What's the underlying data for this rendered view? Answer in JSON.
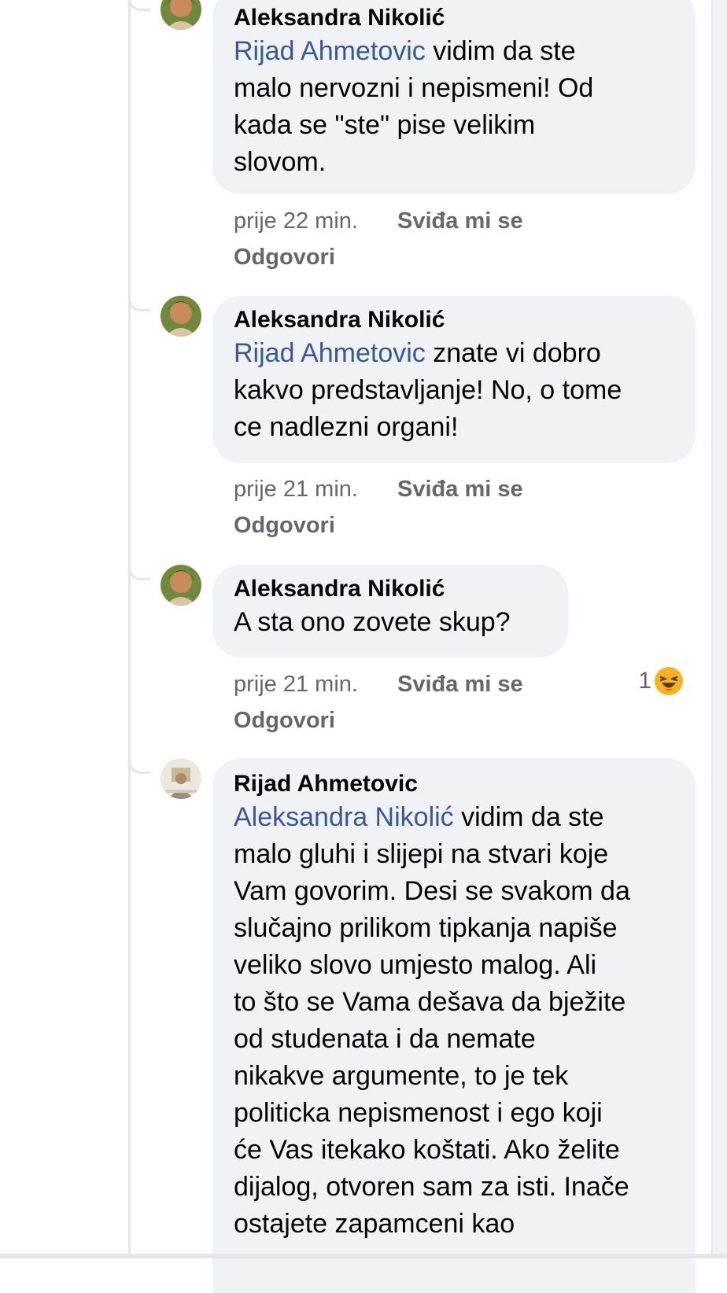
{
  "comments": [
    {
      "author": "Aleksandra Nikolić",
      "mention": "Rijad Ahmetovic",
      "body": " vidim da ste\nmalo nervozni i nepismeni! Od\nkada se \"ste\" pise velikim\nslovom.",
      "time": "prije 22 min.",
      "like": "Sviđa mi se",
      "reply": "Odgovori"
    },
    {
      "author": "Aleksandra Nikolić",
      "mention": "Rijad Ahmetovic",
      "body": " znate vi dobro\nkakvo predstavljanje! No, o tome\nce nadlezni organi!",
      "time": "prije 21 min.",
      "like": "Sviđa mi se",
      "reply": "Odgovori"
    },
    {
      "author": "Aleksandra Nikolić",
      "mention": "",
      "body": "A sta ono zovete skup?",
      "time": "prije 21 min.",
      "like": "Sviđa mi se",
      "reply": "Odgovori",
      "reaction_count": "1",
      "reaction_icon": "haha-emoji-icon"
    },
    {
      "author": "Rijad Ahmetovic",
      "mention": "Aleksandra Nikolić",
      "body": " vidim da ste\nmalo gluhi i slijepi na stvari koje\nVam govorim. Desi se svakom da\nslučajno prilikom tipkanja napiše\nveliko slovo umjesto malog. Ali\nto što se Vama dešava da bježite\nod studenata i da nemate\nnikakve argumente, to je tek\npoliticka nepismenost i ego koji\nće Vas itekako koštati. Ako želite\ndijalog, otvoren sam za isti. Inače\nostajete zapamceni kao"
    }
  ],
  "colors": {
    "mention": "#385898",
    "bubble": "#f0f2f5",
    "meta": "#65676b",
    "reaction": "#f7b125"
  }
}
